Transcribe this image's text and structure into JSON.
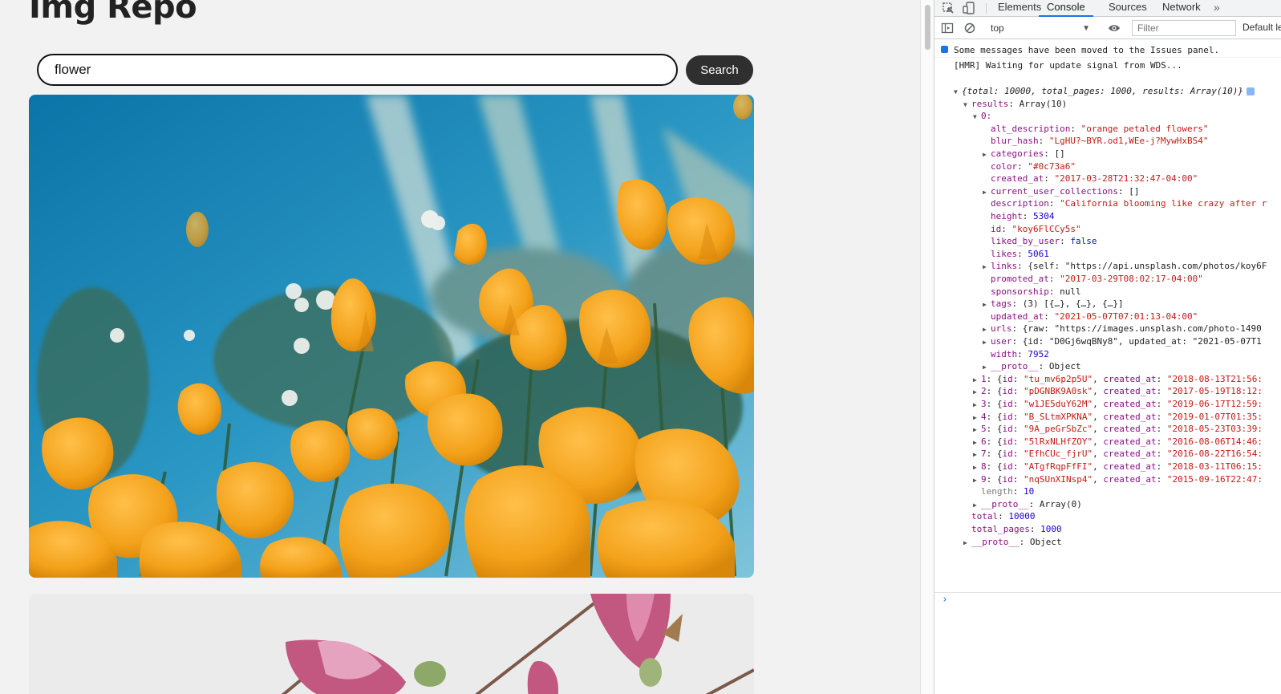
{
  "app": {
    "title": "Img Repo",
    "search": {
      "value": "flower",
      "placeholder": ""
    },
    "search_button": "Search",
    "photos": [
      {
        "alt": "orange petaled flowers",
        "color": "#0c73a6"
      },
      {
        "alt": "pink flower buds",
        "color": "#f0ecec"
      }
    ]
  },
  "devtools": {
    "tabs": [
      "Elements",
      "Console",
      "Sources",
      "Network"
    ],
    "overflow": "»",
    "active_tab": "Console",
    "context": "top",
    "filter_placeholder": "Filter",
    "default_levels": "Default levels",
    "messages": {
      "issues": "Some messages have been moved to the Issues panel.",
      "hmr": "[HMR] Waiting for update signal from WDS..."
    },
    "log": {
      "summary": "{total: 10000, total_pages: 1000, results: Array(10)}",
      "results_label": "results: Array(10)",
      "item0_label": "0:",
      "item0_fields": [
        {
          "key": "alt_description",
          "val": "\"orange petaled flowers\"",
          "kind": "s",
          "expand": false
        },
        {
          "key": "blur_hash",
          "val": "\"LgHU?~BYR.od1,WEe-j?MywHxBS4\"",
          "kind": "s",
          "expand": false
        },
        {
          "key": "categories",
          "val": "[]",
          "kind": "p",
          "expand": true
        },
        {
          "key": "color",
          "val": "\"#0c73a6\"",
          "kind": "s",
          "expand": false
        },
        {
          "key": "created_at",
          "val": "\"2017-03-28T21:32:47-04:00\"",
          "kind": "s",
          "expand": false
        },
        {
          "key": "current_user_collections",
          "val": "[]",
          "kind": "p",
          "expand": true
        },
        {
          "key": "description",
          "val": "\"California blooming like crazy after r",
          "kind": "s",
          "expand": false
        },
        {
          "key": "height",
          "val": "5304",
          "kind": "n",
          "expand": false
        },
        {
          "key": "id",
          "val": "\"koy6FlCCy5s\"",
          "kind": "s",
          "expand": false
        },
        {
          "key": "liked_by_user",
          "val": "false",
          "kind": "b",
          "expand": false
        },
        {
          "key": "likes",
          "val": "5061",
          "kind": "n",
          "expand": false
        },
        {
          "key": "links",
          "val": "{self: \"https://api.unsplash.com/photos/koy6F",
          "kind": "o",
          "expand": true
        },
        {
          "key": "promoted_at",
          "val": "\"2017-03-29T08:02:17-04:00\"",
          "kind": "s",
          "expand": false
        },
        {
          "key": "sponsorship",
          "val": "null",
          "kind": "p",
          "expand": false
        },
        {
          "key": "tags",
          "val": "(3) [{…}, {…}, {…}]",
          "kind": "p",
          "expand": true
        },
        {
          "key": "updated_at",
          "val": "\"2021-05-07T07:01:13-04:00\"",
          "kind": "s",
          "expand": false
        },
        {
          "key": "urls",
          "val": "{raw: \"https://images.unsplash.com/photo-1490",
          "kind": "o",
          "expand": true
        },
        {
          "key": "user",
          "val": "{id: \"D0Gj6wqBNy8\", updated_at: \"2021-05-07T1",
          "kind": "o",
          "expand": true
        },
        {
          "key": "width",
          "val": "7952",
          "kind": "n",
          "expand": false
        },
        {
          "key": "__proto__",
          "val": "Object",
          "kind": "p",
          "expand": true
        }
      ],
      "items": [
        {
          "idx": "1",
          "id": "\"tu_mv6p2p5U\"",
          "created": "\"2018-08-13T21:56:"
        },
        {
          "idx": "2",
          "id": "\"pDGNBK9A0sk\"",
          "created": "\"2017-05-19T18:12:"
        },
        {
          "idx": "3",
          "id": "\"w1JE5duY62M\"",
          "created": "\"2019-06-17T12:59:"
        },
        {
          "idx": "4",
          "id": "\"B_SLtmXPKNA\"",
          "created": "\"2019-01-07T01:35:"
        },
        {
          "idx": "5",
          "id": "\"9A_peGrSbZc\"",
          "created": "\"2018-05-23T03:39:"
        },
        {
          "idx": "6",
          "id": "\"5lRxNLHfZOY\"",
          "created": "\"2016-08-06T14:46:"
        },
        {
          "idx": "7",
          "id": "\"EfhCUc_fjrU\"",
          "created": "\"2016-08-22T16:54:"
        },
        {
          "idx": "8",
          "id": "\"ATgfRqpFfFI\"",
          "created": "\"2018-03-11T06:15:"
        },
        {
          "idx": "9",
          "id": "\"nqSUnXINsp4\"",
          "created": "\"2015-09-16T22:47:"
        }
      ],
      "length_line": {
        "key": "length",
        "val": "10"
      },
      "results_proto": {
        "key": "__proto__",
        "val": "Array(0)"
      },
      "total_line": {
        "key": "total",
        "val": "10000"
      },
      "total_pages_line": {
        "key": "total_pages",
        "val": "1000"
      },
      "root_proto": {
        "key": "__proto__",
        "val": "Object"
      }
    }
  }
}
